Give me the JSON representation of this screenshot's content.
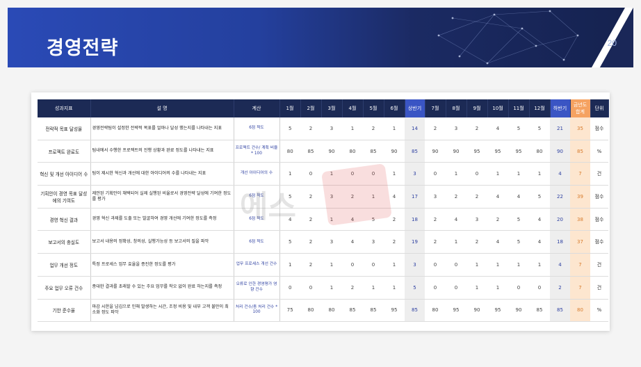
{
  "slide": {
    "title": "경영전략",
    "page_number": "20"
  },
  "table": {
    "headers": {
      "kpi": "성과지표",
      "desc": "설 명",
      "calc": "계산",
      "m1": "1월",
      "m2": "2월",
      "m3": "3월",
      "m4": "4월",
      "m5": "5월",
      "m6": "6월",
      "h1": "상반기",
      "m7": "7월",
      "m8": "8월",
      "m9": "9월",
      "m10": "10월",
      "m11": "11월",
      "m12": "12월",
      "h2": "하반기",
      "total": "금년도 합계",
      "unit": "단위"
    },
    "rows": [
      {
        "kpi": "전략적 목표 달성율",
        "desc": "경영전략팀이 설정한 전략적 목표를 얼마나 달성 했는지를 나타내는 지표",
        "calc": "6점 척도",
        "m": [
          "5",
          "2",
          "3",
          "1",
          "2",
          "1"
        ],
        "h1": "14",
        "m2": [
          "2",
          "3",
          "2",
          "4",
          "5",
          "5"
        ],
        "h2": "21",
        "total": "35",
        "unit": "점수"
      },
      {
        "kpi": "프로젝트 완료도",
        "desc": "팀내에서 수행한 프로젝트의 진행 상황과 완료 정도를 나타내는 지표",
        "calc": "프로젝트 건수/ 계획 비율 * 100",
        "m": [
          "80",
          "85",
          "90",
          "80",
          "85",
          "90"
        ],
        "h1": "85",
        "m2": [
          "90",
          "90",
          "95",
          "95",
          "95",
          "80"
        ],
        "h2": "90",
        "total": "85",
        "unit": "%"
      },
      {
        "kpi": "혁신 및 개선 아이디어 수",
        "desc": "팀이 제시한 혁신과 개선에 대한 아이디어의 수를 나타내는 지표",
        "calc": "개선 아이디어의 수",
        "m": [
          "1",
          "0",
          "1",
          "0",
          "0",
          "1"
        ],
        "h1": "3",
        "m2": [
          "0",
          "1",
          "0",
          "1",
          "1",
          "1"
        ],
        "h2": "4",
        "total": "7",
        "unit": "건"
      },
      {
        "kpi": "기획안이 경영 목표 달성에의 기여도",
        "desc": "제안된 기획안이 채택되어 실제 실행된 비율로서 경영전략 달성에 기여한 정도를 평가",
        "calc": "6점 척도",
        "m": [
          "5",
          "2",
          "3",
          "2",
          "1",
          "4"
        ],
        "h1": "17",
        "m2": [
          "3",
          "2",
          "2",
          "4",
          "4",
          "5"
        ],
        "h2": "22",
        "total": "39",
        "unit": "점수"
      },
      {
        "kpi": "경영 혁신 결과",
        "desc": "경영 혁신 과제를 도출 또는 발굴하여 경영 개선에 기여한 정도를 측정",
        "calc": "6점 척도",
        "m": [
          "4",
          "2",
          "1",
          "4",
          "5",
          "2"
        ],
        "h1": "18",
        "m2": [
          "2",
          "4",
          "3",
          "2",
          "5",
          "4"
        ],
        "h2": "20",
        "total": "38",
        "unit": "점수"
      },
      {
        "kpi": "보고서의 충실도",
        "desc": "보고서 내용의 정확성, 창의성, 실행가능성 등 보고서의 질을 파악",
        "calc": "6점 척도",
        "m": [
          "5",
          "2",
          "3",
          "4",
          "3",
          "2"
        ],
        "h1": "19",
        "m2": [
          "2",
          "1",
          "2",
          "4",
          "5",
          "4"
        ],
        "h2": "18",
        "total": "37",
        "unit": "점수"
      },
      {
        "kpi": "업무 개선 정도",
        "desc": "특정 프로세스 업무 효율을 증진한 정도를 평가",
        "calc": "업무 프로세스 개선 건수",
        "m": [
          "1",
          "2",
          "1",
          "0",
          "0",
          "1"
        ],
        "h1": "3",
        "m2": [
          "0",
          "0",
          "1",
          "1",
          "1",
          "1"
        ],
        "h2": "4",
        "total": "7",
        "unit": "건"
      },
      {
        "kpi": "주요 업무 오류 건수",
        "desc": "종대한 결과를 초래할 수 있는 주요 업무를 착오 없이 완료 하는지를 측정",
        "calc": "오류로 인한 경영평가 영향 건수",
        "m": [
          "0",
          "0",
          "1",
          "2",
          "1",
          "1"
        ],
        "h1": "5",
        "m2": [
          "0",
          "0",
          "1",
          "1",
          "0",
          "0"
        ],
        "h2": "2",
        "total": "7",
        "unit": "건"
      },
      {
        "kpi": "기한 준수율",
        "desc": "마감 시한을 넘김으로 인해 발생하는 시간, 조정 비용 및 내부 고객 불만이 최소화 정도 파악",
        "calc": "처리 건수/총 처리 건수 * 100",
        "m": [
          "75",
          "80",
          "80",
          "85",
          "85",
          "95"
        ],
        "h1": "85",
        "m2": [
          "80",
          "95",
          "90",
          "95",
          "90",
          "85"
        ],
        "h2": "85",
        "total": "80",
        "unit": "%"
      }
    ]
  },
  "watermark": {
    "text": "에스"
  },
  "colors": {
    "banner_start": "#2a4ab6",
    "banner_end": "#15224f",
    "header_bg": "#1c2a55",
    "half_header": "#3a55c4",
    "total_header": "#f5a261",
    "total_cell": "#fde6cf",
    "total_text": "#d77a2a",
    "half_text": "#2b3ea0"
  }
}
